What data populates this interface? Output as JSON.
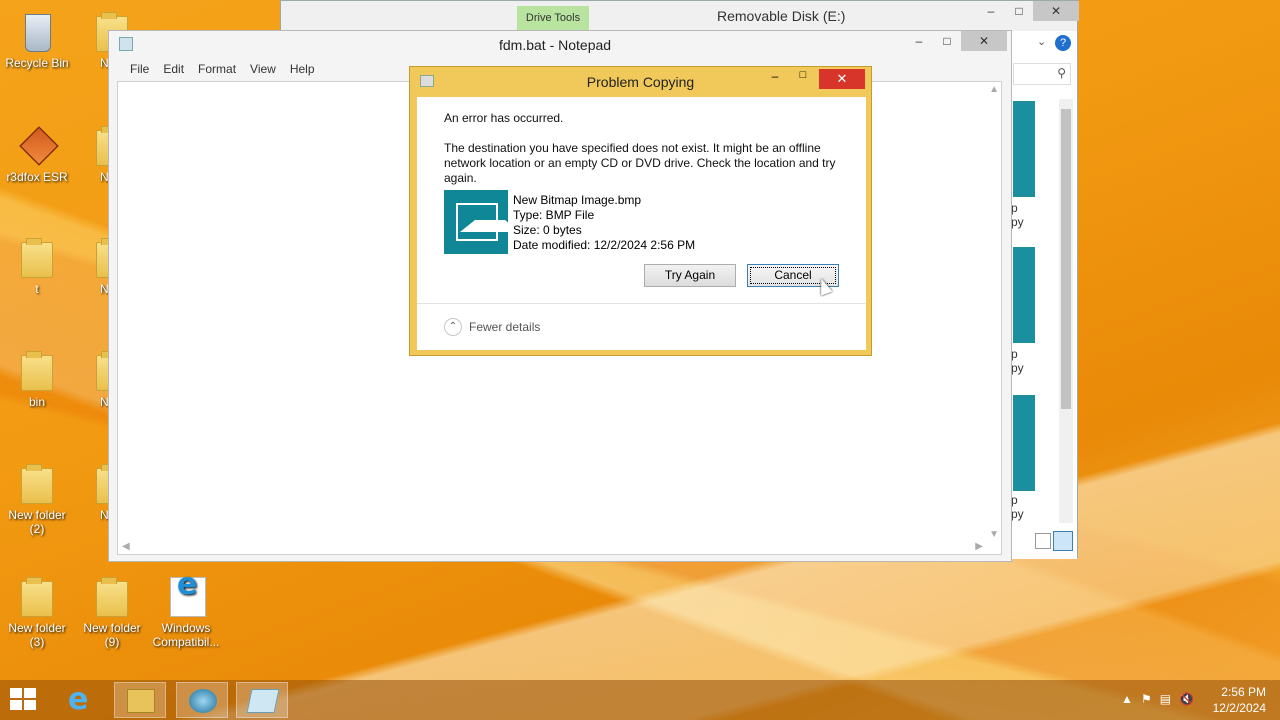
{
  "desktop": {
    "icons": [
      {
        "label": "Recycle Bin",
        "icon": "recycle-bin-icon"
      },
      {
        "label": "r3dfox ESR",
        "icon": "r3dfox-icon"
      },
      {
        "label": "t",
        "icon": "folder-icon"
      },
      {
        "label": "bin",
        "icon": "folder-icon"
      },
      {
        "label": "New folder (2)",
        "icon": "folder-icon"
      },
      {
        "label": "New folder (3)",
        "icon": "folder-icon"
      },
      {
        "label": "New folder (9)",
        "icon": "folder-icon"
      },
      {
        "label": "Windows Compatibil...",
        "icon": "internet-explorer-icon"
      }
    ],
    "partial_labels": [
      "New",
      "New",
      "New",
      "New",
      "New"
    ]
  },
  "explorer": {
    "title": "Removable Disk (E:)",
    "ribbon_tab": "Drive Tools",
    "partial_items": [
      {
        "line1": "p",
        "line2": "py"
      },
      {
        "line1": "p",
        "line2": "py"
      },
      {
        "line1": "p",
        "line2": "py"
      }
    ]
  },
  "notepad": {
    "title": "fdm.bat - Notepad",
    "menu": [
      "File",
      "Edit",
      "Format",
      "View",
      "Help"
    ]
  },
  "dialog": {
    "title": "Problem Copying",
    "heading": "An error has occurred.",
    "message": "The destination you have specified does not exist. It might be an offline network location or an empty CD or DVD drive. Check the location and try again.",
    "file": {
      "name": "New Bitmap Image.bmp",
      "type": "Type: BMP File",
      "size": "Size: 0 bytes",
      "modified": "Date modified: 12/2/2024 2:56 PM"
    },
    "try_again_label": "Try Again",
    "cancel_label": "Cancel",
    "details_label": "Fewer details"
  },
  "taskbar": {
    "items": [
      "internet-explorer-icon",
      "file-explorer-icon",
      "browser-icon",
      "notepad-icon"
    ],
    "time": "2:56 PM",
    "date": "12/2/2024"
  },
  "colors": {
    "desktop": "#f29a12",
    "dialog_frame": "#f1c95b",
    "close_button": "#d8352a",
    "teal": "#0f8796"
  }
}
